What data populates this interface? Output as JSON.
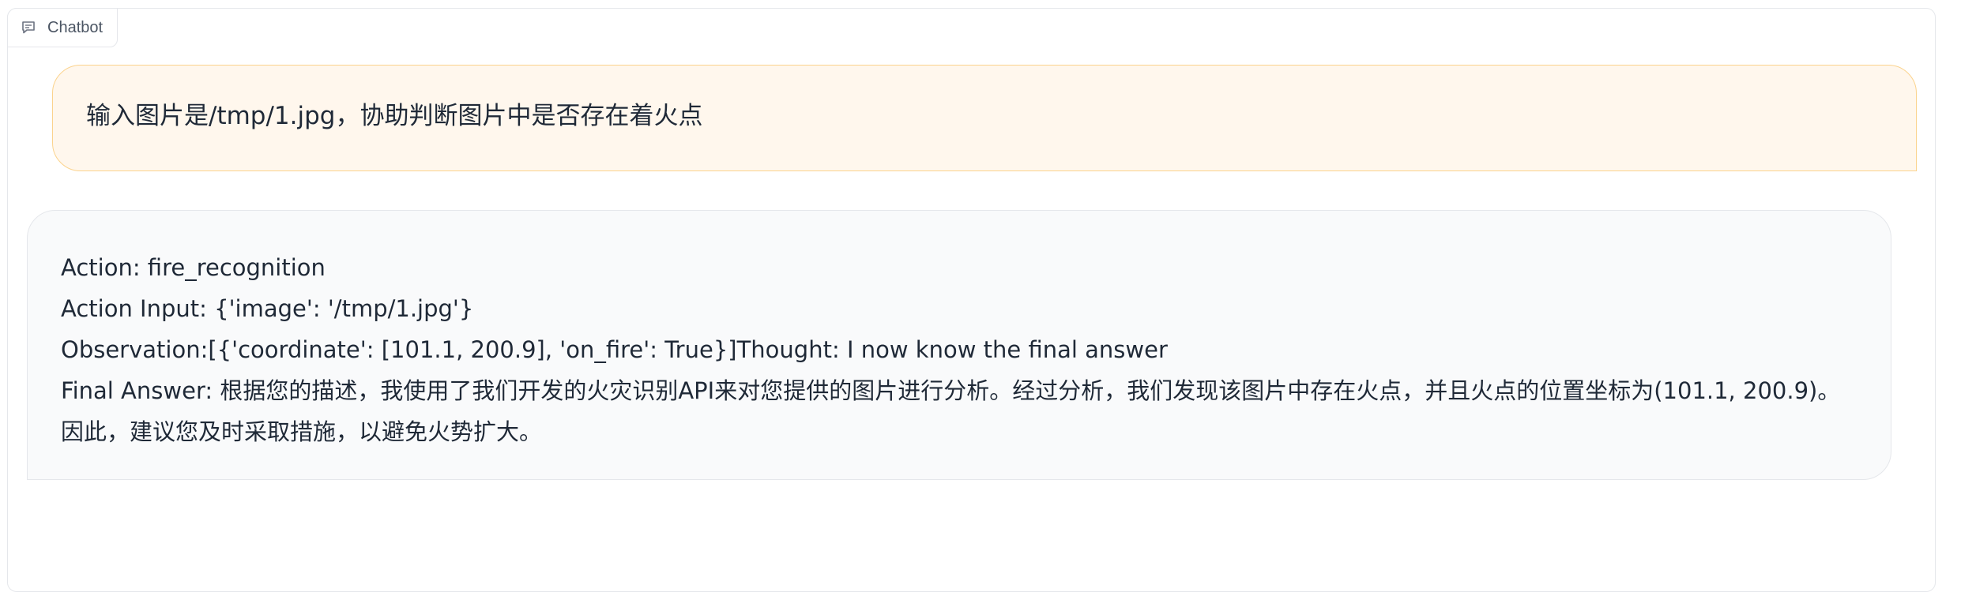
{
  "chatbot": {
    "label": "Chatbot",
    "icon": "chat-bubble-icon"
  },
  "messages": {
    "user": {
      "text": "输入图片是/tmp/1.jpg，协助判断图片中是否存在着火点"
    },
    "bot": {
      "lines": [
        "Action: fire_recognition",
        "Action Input: {'image': '/tmp/1.jpg'}",
        "Observation:[{'coordinate': [101.1, 200.9], 'on_fire': True}]Thought: I now know the final answer",
        "Final Answer: 根据您的描述，我使用了我们开发的火灾识别API来对您提供的图片进行分析。经过分析，我们发现该图片中存在火点，并且火点的位置坐标为(101.1, 200.9)。因此，建议您及时采取措施，以避免火势扩大。"
      ]
    }
  },
  "colors": {
    "user_bubble_bg": "#fff7ed",
    "user_bubble_border": "#fbd38d",
    "bot_bubble_bg": "#f9fafb",
    "bot_bubble_border": "#e5e7eb"
  }
}
